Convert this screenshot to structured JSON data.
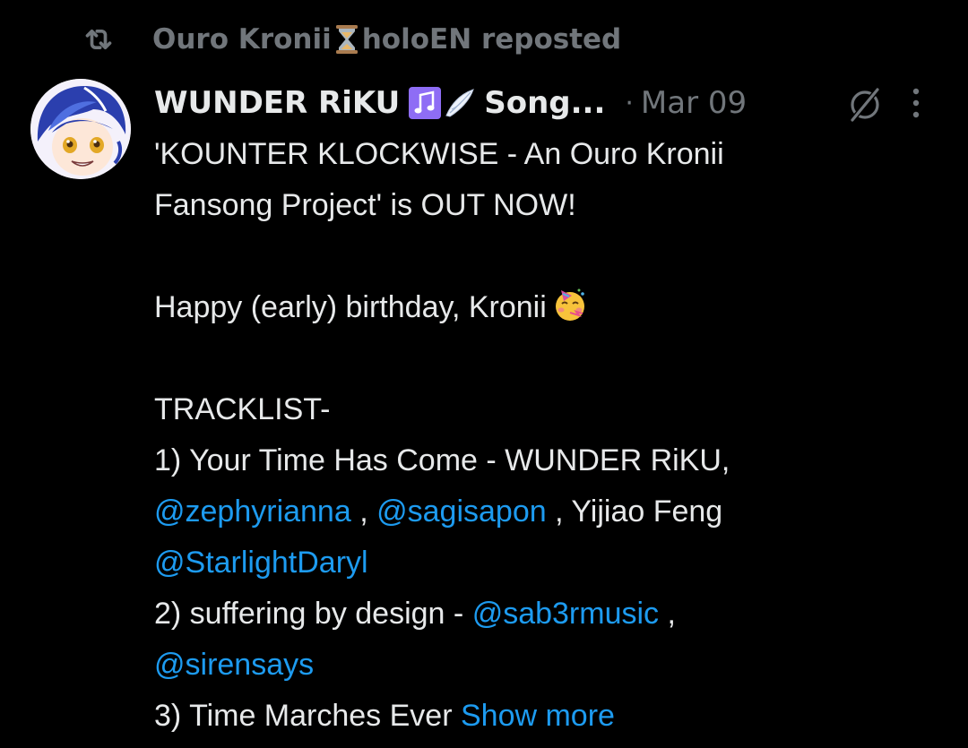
{
  "repost": {
    "user": "Ouro Kronii",
    "user_suffix": "holoEN reposted",
    "icon": "repost-icon"
  },
  "tweet": {
    "author": {
      "name": "WUNDER RiKU",
      "name_tail": "Song...",
      "avatar": "avatar"
    },
    "separator": "·",
    "date": "Mar 09",
    "lines": {
      "l1": "'KOUNTER KLOCKWISE - An Ouro Kronii",
      "l2": "Fansong Project' is OUT NOW!",
      "l3": "Happy (early) birthday, Kronii",
      "l4": "TRACKLIST-",
      "l5": "1) Your Time Has Come - WUNDER RiKU,",
      "l6_m1": "@zephyrianna",
      "l6_sep": " , ",
      "l6_m2": "@sagisapon",
      "l6_tail": " , Yijiao Feng",
      "l7_m": "@StarlightDaryl",
      "l8_pre": "2) suffering by design - ",
      "l8_m": "@sab3rmusic",
      "l8_tail": " ,",
      "l9_m": "@sirensays",
      "l10": "3) Time Marches Ever "
    },
    "show_more": "Show more"
  },
  "colors": {
    "background": "#000000",
    "text": "#e7e9ea",
    "muted": "#71767b",
    "link": "#1d9bf0"
  }
}
